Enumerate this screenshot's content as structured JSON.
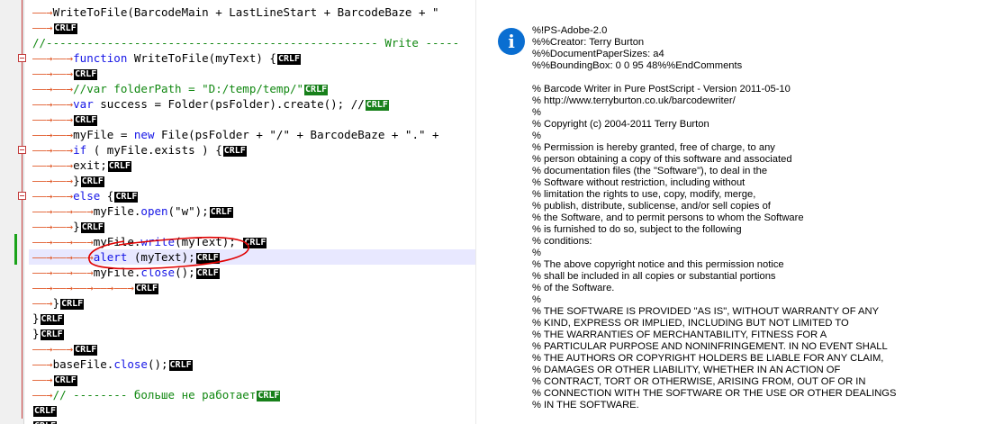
{
  "editor": {
    "lines": [
      {
        "type": "code",
        "indent": 1,
        "parts": [
          {
            "t": "WriteToFile",
            "c": "f"
          },
          {
            "t": "(BarcodeMain + LastLineStart + BarcodeBaze + \"",
            "c": "f"
          }
        ],
        "eol": "",
        "hl": false
      },
      {
        "type": "code",
        "indent": 1,
        "parts": [],
        "eol": "CRLF",
        "hl": false
      },
      {
        "type": "code",
        "indent": 0,
        "parts": [
          {
            "t": "//------------------------------------------------- Write -----",
            "c": "c"
          }
        ],
        "eol": "",
        "hl": false
      },
      {
        "type": "code",
        "indent": 2,
        "parts": [
          {
            "t": "function",
            "c": "k"
          },
          {
            "t": " WriteToFile(myText) {",
            "c": "f"
          }
        ],
        "eol": "CRLF",
        "hl": false
      },
      {
        "type": "code",
        "indent": 2,
        "parts": [],
        "eol": "CRLF",
        "hl": false
      },
      {
        "type": "code",
        "indent": 2,
        "parts": [
          {
            "t": "//var folderPath = \"D:/temp/temp/\"",
            "c": "c"
          }
        ],
        "eol": "CRLF-green",
        "hl": false
      },
      {
        "type": "code",
        "indent": 2,
        "parts": [
          {
            "t": "var",
            "c": "k"
          },
          {
            "t": " success = Folder(psFolder).create(); //",
            "c": "f"
          }
        ],
        "eol": "CRLF-green",
        "hl": false
      },
      {
        "type": "code",
        "indent": 2,
        "parts": [],
        "eol": "CRLF",
        "hl": false
      },
      {
        "type": "code",
        "indent": 2,
        "parts": [
          {
            "t": "myFile = ",
            "c": "f"
          },
          {
            "t": "new",
            "c": "k"
          },
          {
            "t": " File(psFolder + \"/\" + BarcodeBaze + \".\" +",
            "c": "f"
          }
        ],
        "eol": "",
        "hl": false
      },
      {
        "type": "code",
        "indent": 2,
        "parts": [
          {
            "t": "if",
            "c": "k"
          },
          {
            "t": " ( myFile.exists ) {",
            "c": "f"
          }
        ],
        "eol": "CRLF",
        "hl": false
      },
      {
        "type": "code",
        "indent": 2,
        "parts": [
          {
            "t": "exit;",
            "c": "f"
          }
        ],
        "eol": "CRLF",
        "hl": false
      },
      {
        "type": "code",
        "indent": 2,
        "parts": [
          {
            "t": "}",
            "c": "f"
          }
        ],
        "eol": "CRLF",
        "hl": false
      },
      {
        "type": "code",
        "indent": 2,
        "parts": [
          {
            "t": "else",
            "c": "k"
          },
          {
            "t": " {",
            "c": "f"
          }
        ],
        "eol": "CRLF",
        "hl": false
      },
      {
        "type": "code",
        "indent": 3,
        "parts": [
          {
            "t": "myFile.",
            "c": "f"
          },
          {
            "t": "open",
            "c": "k"
          },
          {
            "t": "(\"w\");",
            "c": "f"
          }
        ],
        "eol": "CRLF",
        "hl": false
      },
      {
        "type": "code",
        "indent": 2,
        "parts": [
          {
            "t": "}",
            "c": "f"
          }
        ],
        "eol": "CRLF",
        "hl": false
      },
      {
        "type": "code",
        "indent": 3,
        "parts": [
          {
            "t": "myFile.",
            "c": "f"
          },
          {
            "t": "write",
            "c": "k"
          },
          {
            "t": "(myText); ",
            "c": "f"
          }
        ],
        "eol": "CRLF",
        "hl": false
      },
      {
        "type": "code",
        "indent": 3,
        "parts": [
          {
            "t": "alert",
            "c": "k"
          },
          {
            "t": " (myText);",
            "c": "f"
          }
        ],
        "eol": "CRLF",
        "hl": true
      },
      {
        "type": "code",
        "indent": 3,
        "parts": [
          {
            "t": "myFile.",
            "c": "f"
          },
          {
            "t": "close",
            "c": "k"
          },
          {
            "t": "();",
            "c": "f"
          }
        ],
        "eol": "CRLF",
        "hl": false
      },
      {
        "type": "code",
        "indent": 5,
        "parts": [],
        "eol": "CRLF",
        "hl": false
      },
      {
        "type": "code",
        "indent": 1,
        "parts": [
          {
            "t": "}",
            "c": "f"
          }
        ],
        "eol": "CRLF",
        "hl": false
      },
      {
        "type": "code",
        "indent": 0,
        "parts": [
          {
            "t": "}",
            "c": "f"
          }
        ],
        "eol": "CRLF",
        "hl": false
      },
      {
        "type": "code",
        "indent": 0,
        "parts": [
          {
            "t": "}",
            "c": "f"
          }
        ],
        "eol": "CRLF",
        "hl": false
      },
      {
        "type": "code",
        "indent": 2,
        "parts": [],
        "eol": "CRLF",
        "hl": false
      },
      {
        "type": "code",
        "indent": 1,
        "parts": [
          {
            "t": "baseFile.",
            "c": "f"
          },
          {
            "t": "close",
            "c": "k"
          },
          {
            "t": "();",
            "c": "f"
          }
        ],
        "eol": "CRLF",
        "hl": false
      },
      {
        "type": "code",
        "indent": 1,
        "parts": [],
        "eol": "CRLF",
        "hl": false
      },
      {
        "type": "code",
        "indent": 1,
        "parts": [
          {
            "t": "// -------- больше не работает",
            "c": "c"
          }
        ],
        "eol": "CRLF-green",
        "hl": false
      },
      {
        "type": "code",
        "indent": 0,
        "parts": [],
        "eol": "CRLF",
        "hl": false
      },
      {
        "type": "code",
        "indent": 0,
        "parts": [],
        "eol": "CRLF",
        "hl": false
      }
    ],
    "crlf_label": "CRLF"
  },
  "dialog": {
    "icon": "info-icon",
    "icon_glyph": "i",
    "message": "%!PS-Adobe-2.0\n%%Creator: Terry Burton\n%%DocumentPaperSizes: a4\n%%BoundingBox: 0 0 95 48%%EndComments\n\n% Barcode Writer in Pure PostScript - Version 2011-05-10\n% http://www.terryburton.co.uk/barcodewriter/\n%\n% Copyright (c) 2004-2011 Terry Burton\n%\n% Permission is hereby granted, free of charge, to any\n% person obtaining a copy of this software and associated\n% documentation files (the \"Software\"), to deal in the\n% Software without restriction, including without\n% limitation the rights to use, copy, modify, merge,\n% publish, distribute, sublicense, and/or sell copies of\n% the Software, and to permit persons to whom the Software\n% is furnished to do so, subject to the following\n% conditions:\n%\n% The above copyright notice and this permission notice\n% shall be included in all copies or substantial portions\n% of the Software.\n%\n% THE SOFTWARE IS PROVIDED \"AS IS\", WITHOUT WARRANTY OF ANY\n% KIND, EXPRESS OR IMPLIED, INCLUDING BUT NOT LIMITED TO\n% THE WARRANTIES OF MERCHANTABILITY, FITNESS FOR A\n% PARTICULAR PURPOSE AND NONINFRINGEMENT. IN NO EVENT SHALL\n% THE AUTHORS OR COPYRIGHT HOLDERS BE LIABLE FOR ANY CLAIM,\n% DAMAGES OR OTHER LIABILITY, WHETHER IN AN ACTION OF\n% CONTRACT, TORT OR OTHERWISE, ARISING FROM, OUT OF OR IN\n% CONNECTION WITH THE SOFTWARE OR THE USE OR OTHER DEALINGS\n% IN THE SOFTWARE."
  },
  "colors": {
    "keyword": "#1515e6",
    "comment": "#118811",
    "tab_arrow": "#e05a2a",
    "crlf_green": "#17801a",
    "info_icon": "#0a6ed1",
    "fold_marker": "#c23b3b",
    "change_bar": "#1aa31a"
  }
}
